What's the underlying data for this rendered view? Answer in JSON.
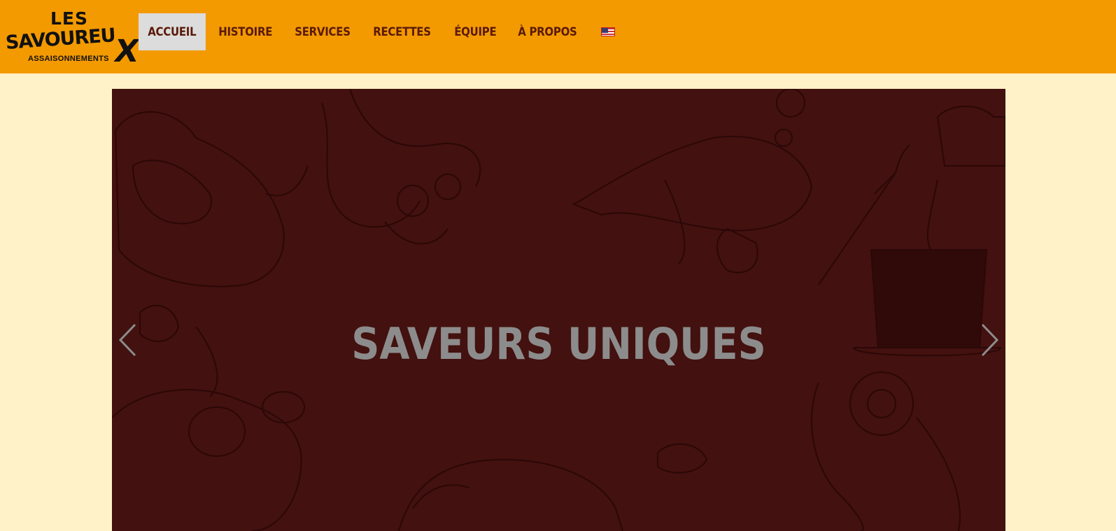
{
  "logo": {
    "line1": "LES",
    "line2": "SAVOUREU",
    "line2_x": "X",
    "line3": "ASSAISONNEMENTS"
  },
  "nav": {
    "items": [
      {
        "label": "ACCUEIL",
        "active": true
      },
      {
        "label": "HISTOIRE"
      },
      {
        "label": "SERVICES"
      },
      {
        "label": "RECETTES"
      },
      {
        "label": "ÉQUIPE"
      },
      {
        "label": "À PROPOS"
      }
    ],
    "language_flag": "us-flag-icon"
  },
  "hero": {
    "title": "SAVEURS UNIQUES",
    "prev_icon": "chevron-left-icon",
    "next_icon": "chevron-right-icon"
  },
  "colors": {
    "header_bg": "#f39a00",
    "page_bg": "#fff2c8",
    "hero_bg": "#43110f",
    "nav_text": "#5a1a0a",
    "hero_title": "#8c8c8c"
  }
}
